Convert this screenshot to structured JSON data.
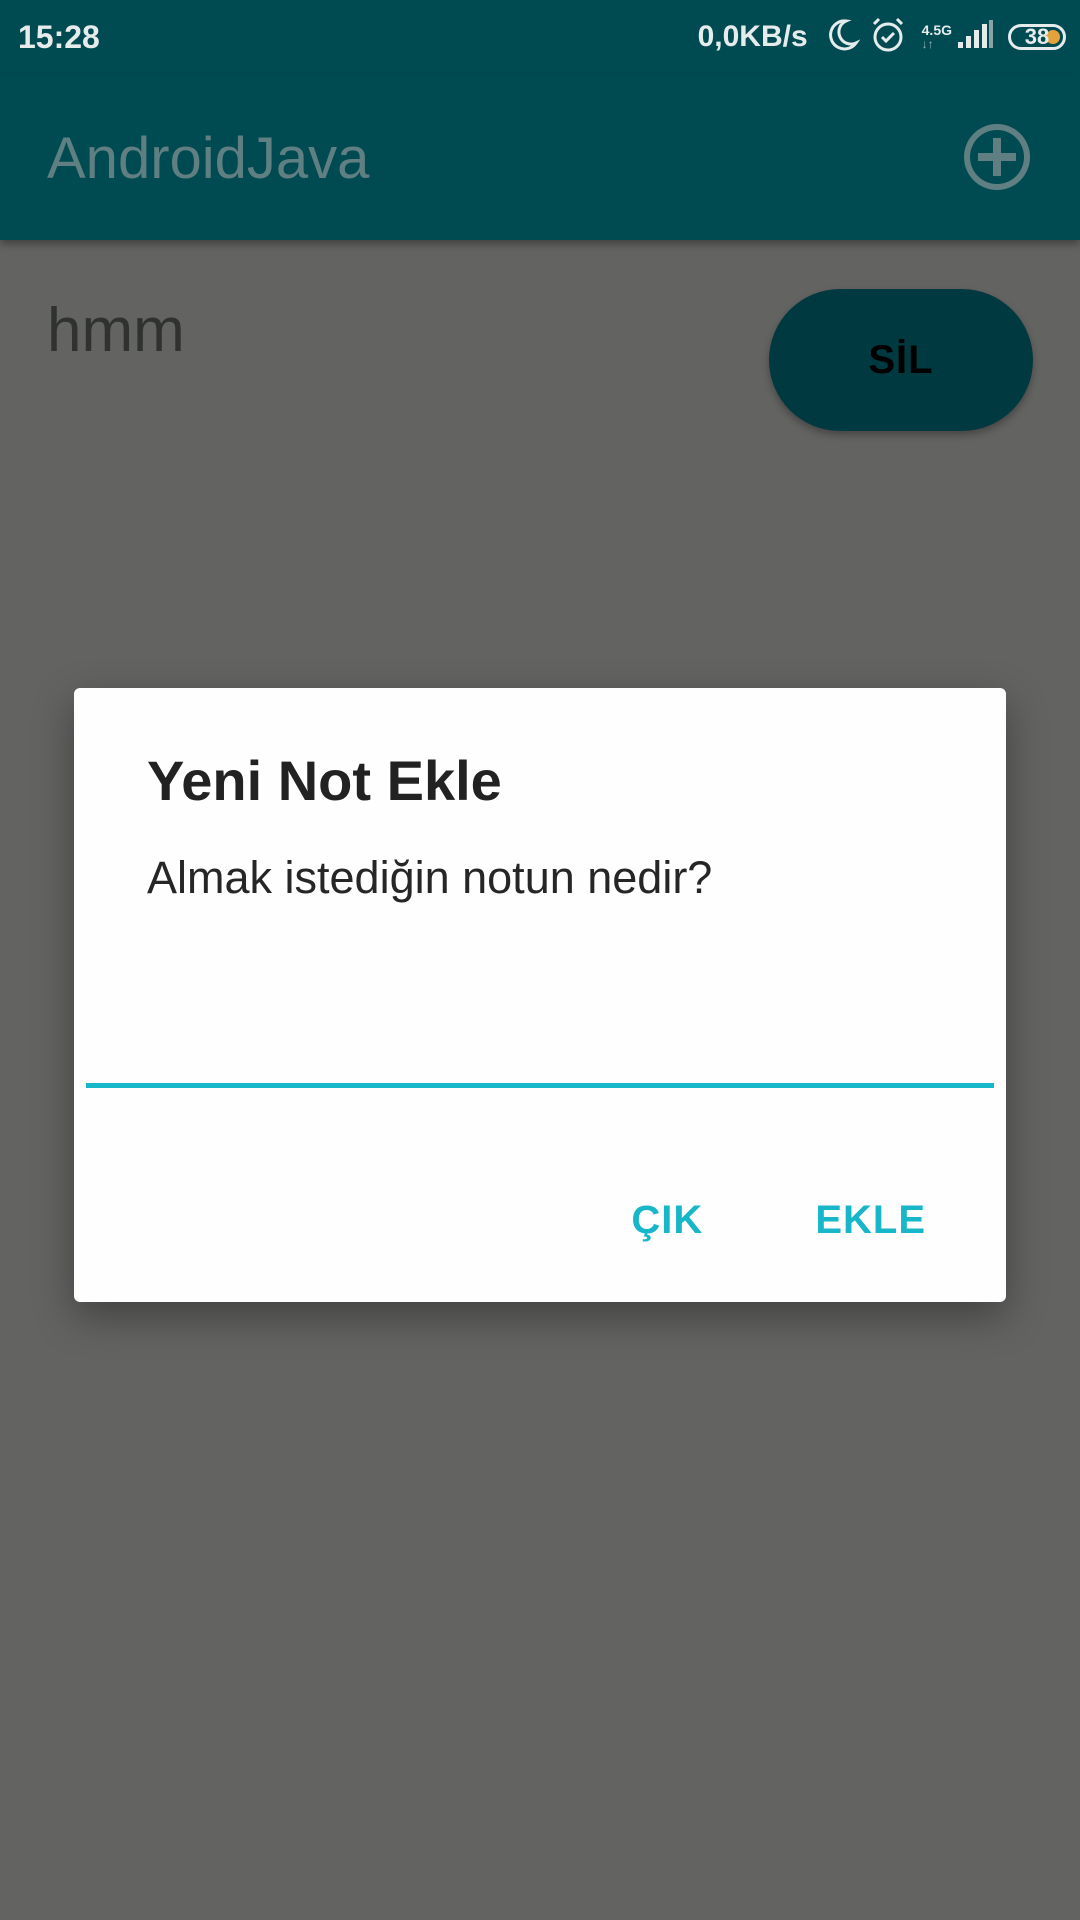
{
  "status_bar": {
    "time": "15:28",
    "net_speed": "0,0KB/s",
    "network_type": "4.5G",
    "battery_level": "38",
    "icons": [
      "moon-icon",
      "alarm-icon",
      "signal-icon",
      "battery-icon"
    ]
  },
  "app_bar": {
    "title": "AndroidJava",
    "add_icon": "add-circle-icon"
  },
  "notes": [
    {
      "text": "hmm",
      "delete_label": "SİL"
    }
  ],
  "dialog": {
    "title": "Yeni Not Ekle",
    "message": "Almak istediğin notun nedir?",
    "input_value": "",
    "cancel_label": "ÇIK",
    "confirm_label": "EKLE"
  },
  "colors": {
    "primary_dark": "#004b52",
    "accent": "#17b6c9",
    "scrim_background": "#636462"
  }
}
